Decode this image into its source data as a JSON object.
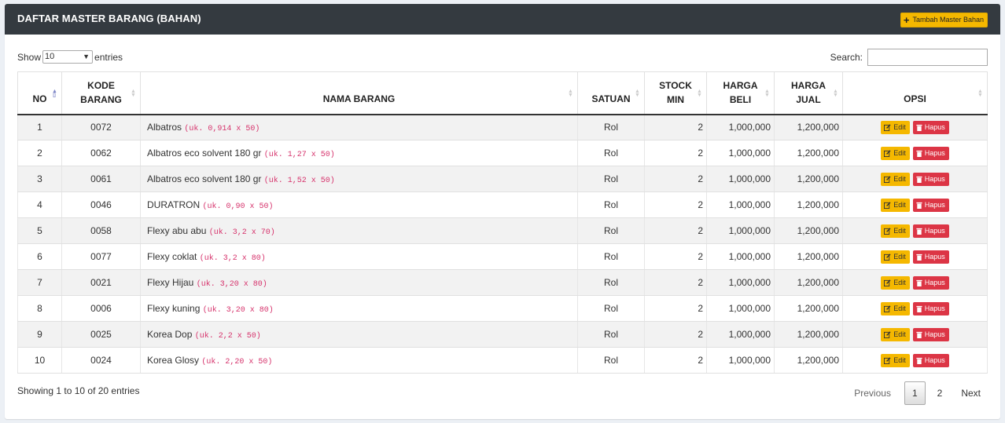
{
  "header": {
    "title": "DAFTAR MASTER BARANG (BAHAN)",
    "add_label": "Tambah Master Bahan"
  },
  "length": {
    "prefix": "Show",
    "value": "10",
    "suffix": "entries"
  },
  "search": {
    "label": "Search:",
    "value": ""
  },
  "columns": [
    "NO",
    "KODE BARANG",
    "NAMA BARANG",
    "SATUAN",
    "STOCK MIN",
    "HARGA BELI",
    "HARGA JUAL",
    "OPSI"
  ],
  "rows": [
    {
      "no": "1",
      "kode": "0072",
      "nama": "Albatros",
      "ukuran": "(uk. 0,914 x 50)",
      "satuan": "Rol",
      "stock": "2",
      "beli": "1,000,000",
      "jual": "1,200,000"
    },
    {
      "no": "2",
      "kode": "0062",
      "nama": "Albatros eco solvent 180 gr",
      "ukuran": "(uk. 1,27 x 50)",
      "satuan": "Rol",
      "stock": "2",
      "beli": "1,000,000",
      "jual": "1,200,000"
    },
    {
      "no": "3",
      "kode": "0061",
      "nama": "Albatros eco solvent 180 gr",
      "ukuran": "(uk. 1,52 x 50)",
      "satuan": "Rol",
      "stock": "2",
      "beli": "1,000,000",
      "jual": "1,200,000"
    },
    {
      "no": "4",
      "kode": "0046",
      "nama": "DURATRON",
      "ukuran": "(uk. 0,90 x 50)",
      "satuan": "Rol",
      "stock": "2",
      "beli": "1,000,000",
      "jual": "1,200,000"
    },
    {
      "no": "5",
      "kode": "0058",
      "nama": "Flexy abu abu",
      "ukuran": "(uk. 3,2 x 70)",
      "satuan": "Rol",
      "stock": "2",
      "beli": "1,000,000",
      "jual": "1,200,000"
    },
    {
      "no": "6",
      "kode": "0077",
      "nama": "Flexy coklat",
      "ukuran": "(uk. 3,2 x 80)",
      "satuan": "Rol",
      "stock": "2",
      "beli": "1,000,000",
      "jual": "1,200,000"
    },
    {
      "no": "7",
      "kode": "0021",
      "nama": "Flexy Hijau",
      "ukuran": "(uk. 3,20 x 80)",
      "satuan": "Rol",
      "stock": "2",
      "beli": "1,000,000",
      "jual": "1,200,000"
    },
    {
      "no": "8",
      "kode": "0006",
      "nama": "Flexy kuning",
      "ukuran": "(uk. 3,20 x 80)",
      "satuan": "Rol",
      "stock": "2",
      "beli": "1,000,000",
      "jual": "1,200,000"
    },
    {
      "no": "9",
      "kode": "0025",
      "nama": "Korea Dop",
      "ukuran": "(uk. 2,2 x 50)",
      "satuan": "Rol",
      "stock": "2",
      "beli": "1,000,000",
      "jual": "1,200,000"
    },
    {
      "no": "10",
      "kode": "0024",
      "nama": "Korea Glosy",
      "ukuran": "(uk. 2,20 x 50)",
      "satuan": "Rol",
      "stock": "2",
      "beli": "1,000,000",
      "jual": "1,200,000"
    }
  ],
  "actions": {
    "edit": "Edit",
    "delete": "Hapus"
  },
  "info": "Showing 1 to 10 of 20 entries",
  "pagination": {
    "previous": "Previous",
    "pages": [
      "1",
      "2"
    ],
    "next": "Next"
  },
  "colors": {
    "header_bg": "#343a40",
    "edit": "#f5b800",
    "delete": "#dc3545",
    "size_text": "#d6336c"
  }
}
